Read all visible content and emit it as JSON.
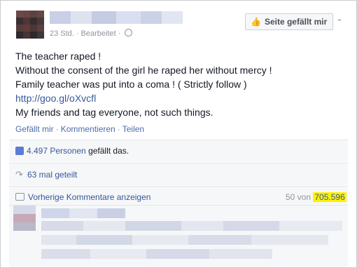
{
  "post": {
    "meta_time": "23 Std.",
    "meta_edited": "Bearbeitet",
    "meta_sep": "·",
    "like_page_label": "Seite gefällt mir",
    "lines": [
      "The teacher raped !",
      "Without the consent of the girl he raped her without mercy !",
      "Family teacher was put into a coma ! ( Strictly follow )",
      "http://goo.gl/oXvcfl",
      "My friends and tag everyone, not such things."
    ],
    "actions": {
      "like": "Gefällt mir",
      "comment": "Kommentieren",
      "share": "Teilen",
      "sep": "·"
    },
    "likes": {
      "count_text": "4.497 Personen",
      "suffix": "gefällt das."
    },
    "shares": {
      "text": "63 mal geteilt"
    },
    "comments": {
      "previous": "Vorherige Kommentare anzeigen",
      "shown_prefix": "50 von",
      "total": "705.596"
    }
  },
  "icons": {
    "thumb": "thumbs-up-icon",
    "chevron": "chevron-down-icon",
    "globe": "globe-icon",
    "share": "share-arrow-icon",
    "comment": "comment-bubble-icon"
  },
  "colors": {
    "link_blue": "#365899",
    "highlight": "#fff200"
  }
}
